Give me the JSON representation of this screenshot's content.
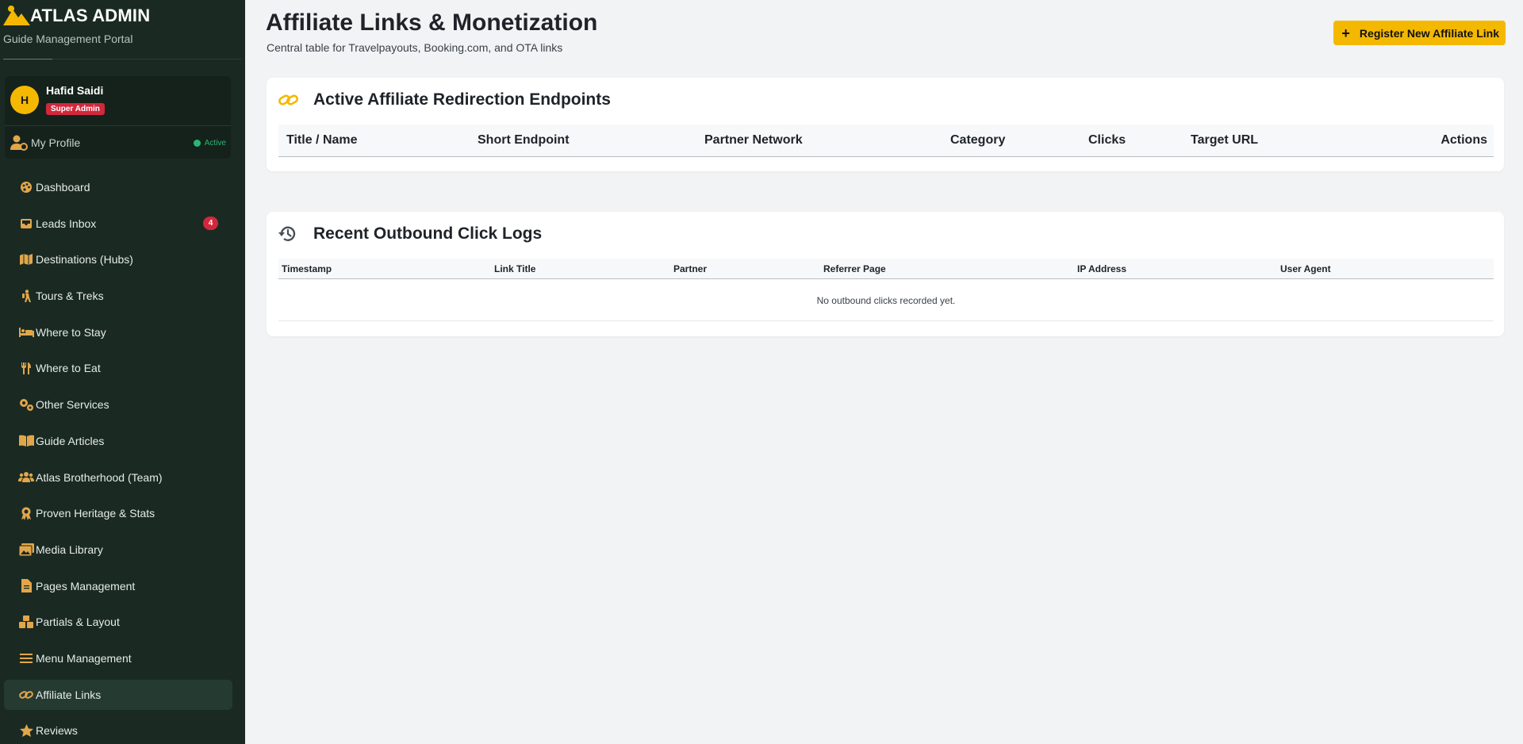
{
  "brand": {
    "title": "ATLAS ADMIN",
    "subtitle": "Guide Management Portal"
  },
  "user": {
    "initial": "H",
    "name": "Hafid Saidi",
    "role": "Super Admin",
    "profile_label": "My Profile",
    "status": "Active"
  },
  "sidebar": {
    "items": [
      {
        "label": "Dashboard",
        "icon": "palette-icon"
      },
      {
        "label": "Leads Inbox",
        "icon": "inbox-icon",
        "badge": "4"
      },
      {
        "label": "Destinations (Hubs)",
        "icon": "map-icon"
      },
      {
        "label": "Tours & Treks",
        "icon": "hiker-icon"
      },
      {
        "label": "Where to Stay",
        "icon": "bed-icon"
      },
      {
        "label": "Where to Eat",
        "icon": "utensils-icon"
      },
      {
        "label": "Other Services",
        "icon": "gears-icon"
      },
      {
        "label": "Guide Articles",
        "icon": "book-icon"
      },
      {
        "label": "Atlas Brotherhood (Team)",
        "icon": "users-icon"
      },
      {
        "label": "Proven Heritage & Stats",
        "icon": "award-icon"
      },
      {
        "label": "Media Library",
        "icon": "images-icon"
      },
      {
        "label": "Pages Management",
        "icon": "file-icon"
      },
      {
        "label": "Partials & Layout",
        "icon": "cubes-icon"
      },
      {
        "label": "Menu Management",
        "icon": "bars-icon"
      },
      {
        "label": "Affiliate Links",
        "icon": "link-icon",
        "active": true
      },
      {
        "label": "Reviews",
        "icon": "star-icon"
      }
    ]
  },
  "header": {
    "title": "Affiliate Links & Monetization",
    "subtitle": "Central table for Travelpayouts, Booking.com, and OTA links",
    "register_button": "Register New Affiliate Link"
  },
  "affiliate_table": {
    "title": "Active Affiliate Redirection Endpoints",
    "columns": [
      "Title / Name",
      "Short Endpoint",
      "Partner Network",
      "Category",
      "Clicks",
      "Target URL",
      "Actions"
    ]
  },
  "click_logs": {
    "title": "Recent Outbound Click Logs",
    "columns": [
      "Timestamp",
      "Link Title",
      "Partner",
      "Referrer Page",
      "IP Address",
      "User Agent"
    ],
    "empty_message": "No outbound clicks recorded yet."
  },
  "colors": {
    "sidebar_bg": "#1a2a23",
    "accent": "#f5b800",
    "badge": "#d2283c",
    "active_status": "#2bb673",
    "icon_gold": "#e2a64a"
  }
}
